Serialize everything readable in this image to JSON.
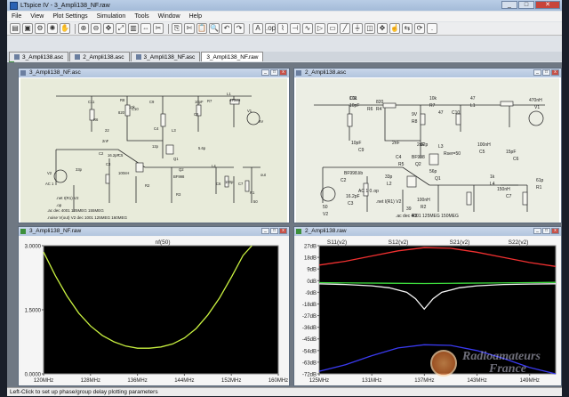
{
  "window": {
    "title": "LTspice IV - 3_Ampli138_NF.raw",
    "minimize": "_",
    "maximize": "□",
    "close": "✕"
  },
  "menu": [
    "File",
    "View",
    "Plot Settings",
    "Simulation",
    "Tools",
    "Window",
    "Help"
  ],
  "toolbar_icons": [
    "open-icon",
    "save-icon",
    "settings-icon",
    "run-icon",
    "halt-icon",
    "zoom-in-icon",
    "zoom-out-icon",
    "pan-icon",
    "zoom-fit-icon",
    "autorange-icon",
    "ruler-icon",
    "delete-icon",
    "copy-icon",
    "cut-icon",
    "paste-icon",
    "find-icon",
    "undo-icon",
    "redo-icon",
    "text-icon",
    "op-icon",
    "resistor-icon",
    "capacitor-icon",
    "inductor-icon",
    "diode-icon",
    "component-icon",
    "wire-icon",
    "ground-icon",
    "label-icon",
    "move-icon",
    "drag-icon",
    "mirror-icon",
    "rotate-icon",
    "spice-directive-icon"
  ],
  "tabs": [
    {
      "label": "3_Ampli138.asc",
      "kind": "schematic"
    },
    {
      "label": "2_Ampli138.asc",
      "kind": "schematic"
    },
    {
      "label": "3_Ampli138_NF.asc",
      "kind": "schematic"
    },
    {
      "label": "3_Ampli138_NF.raw",
      "kind": "waveform",
      "active": true
    }
  ],
  "panes": {
    "top_left": {
      "title": "3_Ampli138_NF.asc",
      "directives": [
        ".ac dec 4001 125MEG 155MEG",
        ".noise V(out) V2 dec 1001 125MEG 160MEG",
        ".net I(R1) V2",
        ".op"
      ],
      "labels": [
        "C11",
        "R6",
        "R8",
        "C10",
        "C9",
        "R7",
        "L1",
        "V1",
        "C4",
        "L3",
        "C8",
        "Q1",
        "Q2",
        "BF998",
        "C2",
        "C3",
        "C5",
        "L4",
        "C6",
        "C7",
        "R1",
        "V2",
        "R2",
        "R3",
        "AC 1",
        "out",
        "10pF",
        "470nH",
        "12p",
        "5.6p",
        "16.2pF",
        "33p",
        "100nH",
        "100p",
        "50",
        "9V",
        "22",
        "820",
        "10k",
        "2nF"
      ]
    },
    "top_right": {
      "title": "2_Ampli138.asc",
      "directives": [
        ".op",
        ".net I(R1) V2",
        ".ac dec 4001 125MEG 150MEG"
      ],
      "labels": [
        "C11",
        "10pF",
        "R6",
        "820",
        "R4",
        "10k",
        "R7",
        "47",
        "L1",
        "470nH",
        "V1",
        "9V",
        "R8",
        "47",
        "C10",
        "10pF",
        "C9",
        "2nF",
        "12p",
        "L3",
        "100nH",
        "C5",
        "15pF",
        "C6",
        "56p",
        "Q1",
        "BF998",
        "Q2",
        "BF998.lib",
        "C2",
        "16.2pF",
        "C3",
        "33p",
        "L2",
        "100nH",
        "R2",
        "39",
        "R3",
        "1k",
        "L4",
        "150nH",
        "C7",
        "61p",
        "R1",
        "50",
        "V2",
        "AC 1 0",
        "Rser=50",
        "2nF",
        "C4",
        "R5",
        "10k"
      ]
    },
    "bottom_left": {
      "title": "3_Ampli138_NF.raw",
      "trace_label": "nf(50)"
    },
    "bottom_right": {
      "title": "2_Ampli138.raw",
      "trace_labels": [
        "S11(v2)",
        "S12(v2)",
        "S21(v2)",
        "S22(v2)"
      ]
    }
  },
  "chart_data": [
    {
      "type": "line",
      "title": "nf(50)",
      "x_ticks": [
        "120MHz",
        "128MHz",
        "136MHz",
        "144MHz",
        "152MHz",
        "160MHz"
      ],
      "y_ticks": [
        "3.0000",
        "1.5000",
        "0.0000"
      ],
      "xlim": [
        120,
        160
      ],
      "ylim": [
        0,
        3.0
      ],
      "grid": false,
      "series": [
        {
          "name": "nf(50)",
          "color": "#c8f040",
          "x": [
            120,
            122,
            124,
            126,
            128,
            130,
            132,
            134,
            136,
            138,
            140,
            142,
            144,
            146,
            148,
            150,
            152,
            154,
            155.5
          ],
          "y": [
            2.85,
            2.3,
            1.82,
            1.42,
            1.12,
            0.9,
            0.75,
            0.65,
            0.6,
            0.6,
            0.63,
            0.7,
            0.84,
            1.06,
            1.38,
            1.78,
            2.26,
            2.77,
            3.0
          ]
        }
      ]
    },
    {
      "type": "line",
      "title": "",
      "x_ticks": [
        "125MHz",
        "131MHz",
        "137MHz",
        "143MHz",
        "149MHz"
      ],
      "y_ticks": [
        "27dB",
        "18dB",
        "9dB",
        "0dB",
        "-9dB",
        "-18dB",
        "-27dB",
        "-36dB",
        "-45dB",
        "-54dB",
        "-63dB",
        "-72dB"
      ],
      "xlim": [
        125,
        152
      ],
      "ylim": [
        -72,
        27
      ],
      "grid": false,
      "series": [
        {
          "name": "S11(v2)",
          "color": "#3ddc3d",
          "x": [
            125,
            129,
            133,
            137,
            141,
            145,
            149,
            152
          ],
          "y": [
            -1.5,
            -1.8,
            -2.0,
            -2.2,
            -2.0,
            -1.8,
            -1.5,
            -1.3
          ]
        },
        {
          "name": "S12(v2)",
          "color": "#3a3af0",
          "x": [
            125,
            128,
            131,
            134,
            137,
            140,
            143,
            146,
            149,
            152
          ],
          "y": [
            -70,
            -65,
            -58,
            -52,
            -49.5,
            -50,
            -54,
            -60,
            -67,
            -72
          ]
        },
        {
          "name": "S21(v2)",
          "color": "#f03030",
          "x": [
            125,
            128,
            131,
            134,
            137,
            140,
            143,
            146,
            149,
            152
          ],
          "y": [
            12,
            15,
            19,
            23,
            25.5,
            25,
            22,
            18,
            14,
            11
          ]
        },
        {
          "name": "S22(v2)",
          "color": "#f5f5f5",
          "x": [
            125,
            128,
            131,
            133,
            135,
            136,
            137,
            138,
            139,
            141,
            143,
            146,
            149,
            152
          ],
          "y": [
            -2.5,
            -3,
            -4,
            -5.5,
            -9,
            -14,
            -22,
            -14,
            -9,
            -5.5,
            -4,
            -3,
            -2.6,
            -2.4
          ]
        }
      ]
    }
  ],
  "status": "Left-Click to set up phase/group delay plotting parameters",
  "watermark": {
    "line1": "Radioamateurs",
    "line2": "France"
  }
}
